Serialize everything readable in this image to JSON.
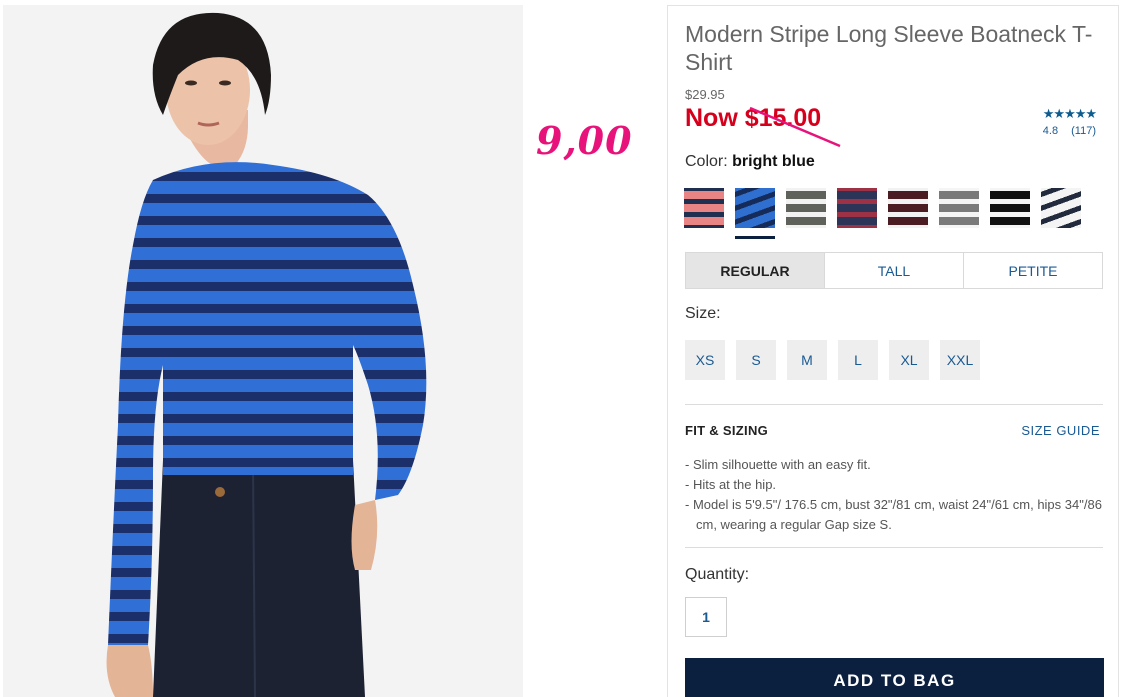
{
  "product": {
    "title": "Modern Stripe Long Sleeve Boatneck T-Shirt",
    "original_price": "$29.95",
    "now_price": "Now $15.00",
    "handwritten_price": "9,00"
  },
  "rating": {
    "stars": "★★★★★",
    "score": "4.8",
    "count": "(117)",
    "value": 4.8
  },
  "color": {
    "label": "Color:",
    "selected": "bright blue",
    "swatches": [
      {
        "name": "coral-navy-stripe",
        "base": "#e88484",
        "stripe": "#1f2f4f"
      },
      {
        "name": "bright-blue-stripe",
        "base": "#2e6fd0",
        "stripe": "#152b5a"
      },
      {
        "name": "grey-white-stripe",
        "base": "#5e625b",
        "stripe": "#f2f2f2"
      },
      {
        "name": "navy-red-stripe",
        "base": "#2c3457",
        "stripe": "#9d3146"
      },
      {
        "name": "burgundy-white-stripe",
        "base": "#4b1d22",
        "stripe": "#f2f2f2"
      },
      {
        "name": "grey-light-stripe",
        "base": "#7a7a7a",
        "stripe": "#f5f5f5"
      },
      {
        "name": "black-white-stripe",
        "base": "#111111",
        "stripe": "#f5f5f5"
      },
      {
        "name": "white-navy-stripe",
        "base": "#f4f4f4",
        "stripe": "#222a3d"
      }
    ]
  },
  "fit_tabs": [
    "REGULAR",
    "TALL",
    "PETITE"
  ],
  "size": {
    "label": "Size:",
    "options": [
      "XS",
      "S",
      "M",
      "L",
      "XL",
      "XXL"
    ]
  },
  "fit_sizing": {
    "heading": "FIT & SIZING",
    "guide_link": "SIZE GUIDE",
    "bullets": [
      "- Slim silhouette with an easy fit.",
      "- Hits at the hip.",
      "- Model is 5'9.5\"/ 176.5 cm, bust 32\"/81 cm, waist 24\"/61 cm, hips 34\"/86 cm, wearing a regular Gap size S."
    ]
  },
  "quantity": {
    "label": "Quantity:",
    "value": "1"
  },
  "cta": {
    "add_to_bag": "ADD TO BAG"
  },
  "colors": {
    "sale_red": "#d6001c",
    "link_blue": "#1a5a93",
    "navy": "#0b1f3f",
    "annotation_pink": "#e8137a"
  }
}
